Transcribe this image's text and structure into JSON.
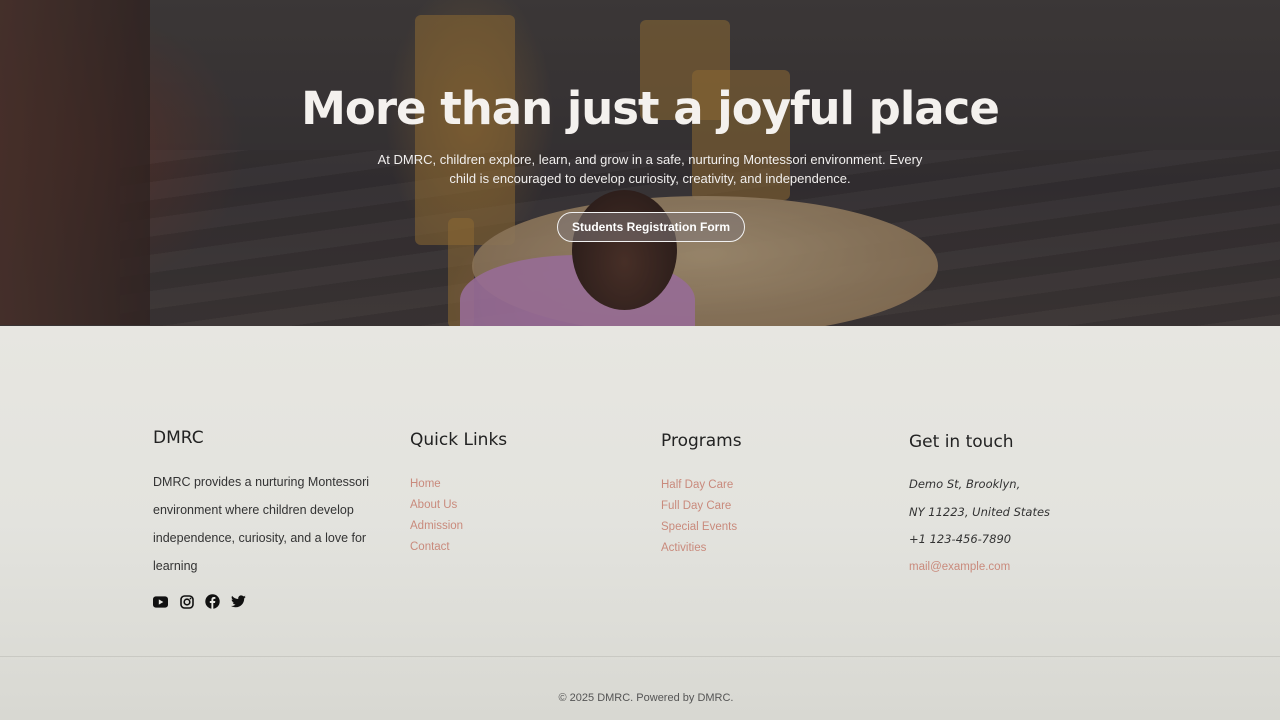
{
  "hero": {
    "title": "More than just a joyful place",
    "text": "At DMRC, children explore, learn, and grow in a safe, nurturing Montessori environment. Every child is encouraged to develop curiosity, creativity, and independence.",
    "button_label": "Students Registration Form"
  },
  "footer": {
    "about": {
      "heading": "DMRC",
      "text": "DMRC provides a nurturing Montessori environment where children develop independence, curiosity, and a love for learning",
      "social_icons": [
        "youtube-icon",
        "instagram-icon",
        "facebook-icon",
        "twitter-icon"
      ]
    },
    "quick_links": {
      "heading": "Quick Links",
      "items": [
        "Home",
        "About Us",
        "Admission",
        "Contact"
      ]
    },
    "programs": {
      "heading": "Programs",
      "items": [
        "Half Day Care",
        "Full Day Care",
        "Special Events",
        "Activities"
      ]
    },
    "contact": {
      "heading": "Get in touch",
      "address_line1": "Demo St, Brooklyn,",
      "address_line2": "NY 11223, United States",
      "phone": "+1 123-456-7890",
      "email": "mail@example.com"
    },
    "copyright": "© 2025 DMRC. Powered by DMRC."
  },
  "colors": {
    "link": "#c98a7c",
    "text": "#333333",
    "footer_bg": "#e5e5e0"
  }
}
